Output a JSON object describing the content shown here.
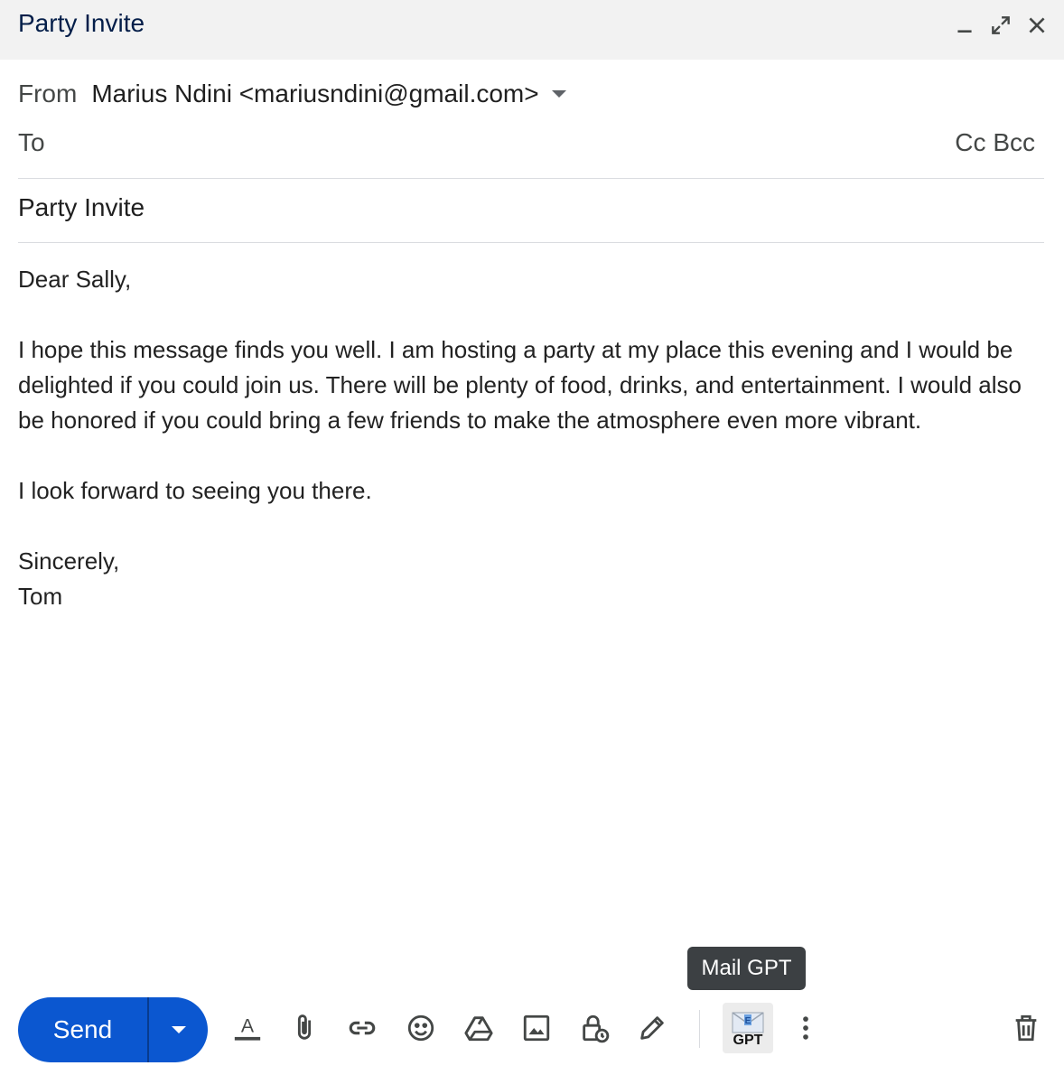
{
  "window": {
    "title": "Party Invite",
    "controls": [
      "minimize-icon",
      "expand-icon",
      "close-icon"
    ]
  },
  "from": {
    "label": "From",
    "value": "Marius Ndini <mariusndini@gmail.com>"
  },
  "to": {
    "label": "To",
    "cc_label": "Cc",
    "bcc_label": "Bcc"
  },
  "subject": {
    "value": "Party Invite"
  },
  "body": {
    "greeting": "Dear Sally,",
    "paragraph1": "I hope this message finds you well. I am hosting a party at my place this evening and I would be delighted if you could join us. There will be plenty of food, drinks, and entertainment. I would also be honored if you could bring a few friends to make the atmosphere even more vibrant.",
    "paragraph2": "I look forward to seeing you there.",
    "closing": "Sincerely,",
    "signature": "Tom"
  },
  "toolbar": {
    "send_label": "Send",
    "tooltip": "Mail GPT",
    "gpt_label": "GPT",
    "icons": [
      "format-text-icon",
      "attach-icon",
      "link-icon",
      "emoji-icon",
      "drive-icon",
      "photo-icon",
      "confidential-icon",
      "signature-icon",
      "mail-gpt-icon",
      "more-options-icon",
      "delete-icon"
    ]
  },
  "colors": {
    "accent": "#0b57d0",
    "titlebar": "#f2f2f2",
    "title_text": "#041e49"
  }
}
